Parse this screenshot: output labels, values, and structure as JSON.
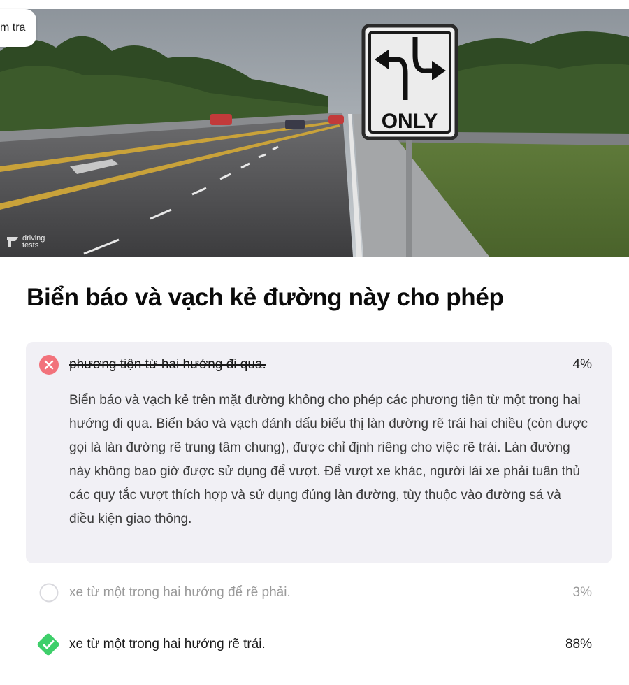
{
  "badge": {
    "label": "m tra"
  },
  "hero": {
    "sign_text": "ONLY",
    "watermark_line1": "driving",
    "watermark_line2": "tests"
  },
  "question": {
    "title": "Biển báo và vạch kẻ đường này cho phép"
  },
  "answers": [
    {
      "text": "phương tiện từ hai hướng đi qua.",
      "percent": "4%",
      "status": "incorrect-selected",
      "icon": "x-circle-icon",
      "explanation": "Biển báo và vạch kẻ trên mặt đường không cho phép các phương tiện từ một trong hai hướng đi qua. Biển báo và vạch đánh dấu biểu thị làn đường rẽ trái hai chiều (còn được gọi là làn đường rẽ trung tâm chung), được chỉ định riêng cho việc rẽ trái. Làn đường này không bao giờ được sử dụng để vượt. Để vượt xe khác, người lái xe phải tuân thủ các quy tắc vượt thích hợp và sử dụng đúng làn đường, tùy thuộc vào đường sá và điều kiện giao thông."
    },
    {
      "text": "xe từ một trong hai hướng để rẽ phải.",
      "percent": "3%",
      "status": "unselected",
      "icon": "empty-circle-icon"
    },
    {
      "text": "xe từ một trong hai hướng rẽ trái.",
      "percent": "88%",
      "status": "correct",
      "icon": "check-diamond-icon"
    }
  ],
  "colors": {
    "incorrect": "#f2727b",
    "correct": "#3ecf6a",
    "panel": "#f1f0f5",
    "muted_text": "#9a9a9a"
  }
}
